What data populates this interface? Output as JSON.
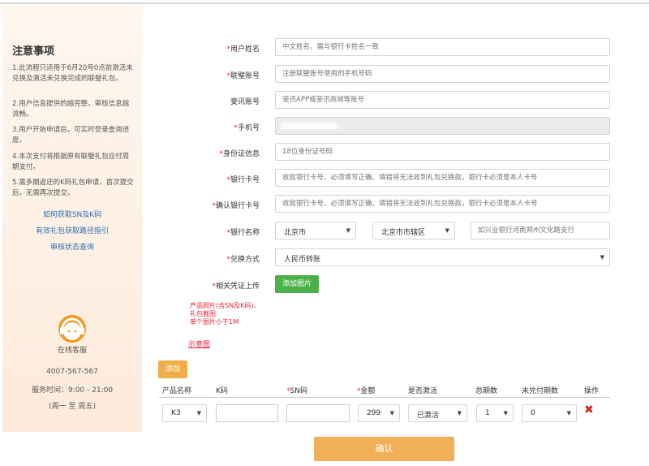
{
  "sidebar": {
    "title": "注意事项",
    "notes": [
      "1.此流程只适用于6月20号0点前激活未兑换及激活未兑换完成的联璧礼包。",
      "2.用户信息提供的越完整，审核信息越流畅。",
      "3.用户开始申请后，可实时登录查询进度。",
      "4.本次支付将根据原有联璧礼包应付周期支付。",
      "5.需多期返还的K码礼包申请，首次提交后，无需再次提交。"
    ],
    "links": [
      "如何获取SN及K码",
      "有效礼包获取路径指引",
      "审核状态查询"
    ],
    "cs_label": "在线客服",
    "phone": "4007-567-567",
    "hours": "服务时间：9:00 - 21:00",
    "days": "(周一 至 周五)"
  },
  "form": {
    "name_label": "用户姓名",
    "name_placeholder": "中文姓名、需与银行卡姓名一致",
    "lianbi_label": "联璧账号",
    "lianbi_placeholder": "注册联璧账号使用的手机号码",
    "feixun_label": "斐讯账号",
    "feixun_placeholder": "斐讯APP或斐讯商城等账号",
    "phone_label": "手机号",
    "id_label": "身份证信息",
    "id_placeholder": "18位身份证号码",
    "card_label": "银行卡号",
    "card_placeholder": "收款银行卡号、必须填写正确、填错将无法收到礼包兑换款，银行卡必须是本人卡号",
    "card_confirm_label": "确认银行卡号",
    "card_confirm_placeholder": "收款银行卡号、必须填写正确、填错将无法收到礼包兑换款，银行卡必须是本人卡号",
    "bank_label": "银行名称",
    "city": "北京市",
    "district": "北京市市辖区",
    "branch_placeholder": "如兴业银行河南郑州文化路支行",
    "method_label": "兑换方式",
    "method_value": "人民币转账",
    "upload_label": "相关凭证上传",
    "upload_button": "添加图片",
    "hint_lines": [
      "产品照片(含SN及K码)、",
      "礼包截图",
      "单个图片小于1M"
    ],
    "sample_link": "示意图"
  },
  "table": {
    "add_button": "添加",
    "headers": [
      "产品名称",
      "K码",
      "SN码",
      "金额",
      "是否激活",
      "总期数",
      "未兑付期数",
      "操作"
    ],
    "row": {
      "product": "K3",
      "amount": "299",
      "activated": "已激活",
      "periods": "1",
      "unpaid": "0"
    }
  },
  "confirm_button": "确认",
  "colors": {
    "required": "#e22233",
    "green": "#4cb04a",
    "orange": "#f2b056",
    "link": "#2b6fb6"
  }
}
